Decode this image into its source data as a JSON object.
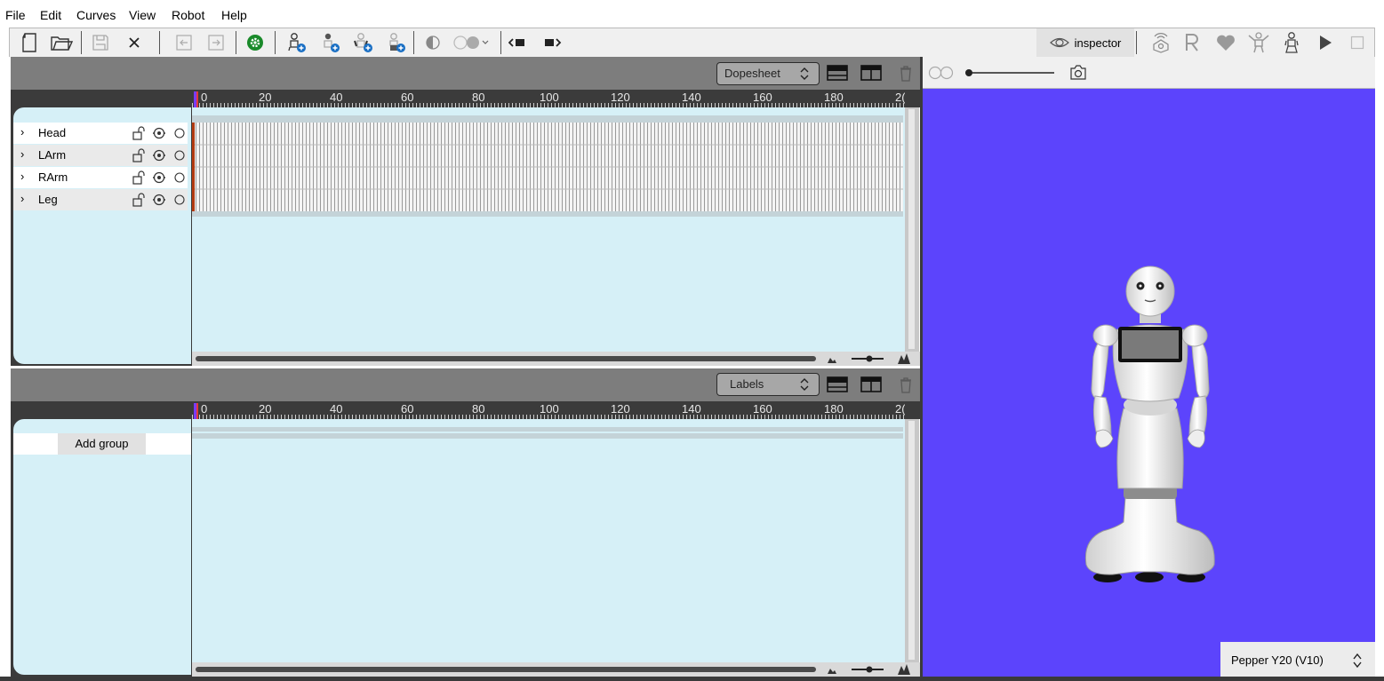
{
  "menu": [
    "File",
    "Edit",
    "Curves",
    "View",
    "Robot",
    "Help"
  ],
  "toolbar": {
    "inspector_label": "inspector"
  },
  "timeline_panel": {
    "mode": "Dopesheet",
    "ruler_labels": [
      "0",
      "20",
      "40",
      "60",
      "80",
      "100",
      "120",
      "140",
      "160",
      "180",
      "2("
    ],
    "groups": [
      {
        "label": "Head"
      },
      {
        "label": "LArm"
      },
      {
        "label": "RArm"
      },
      {
        "label": "Leg"
      }
    ]
  },
  "labels_panel": {
    "mode": "Labels",
    "ruler_labels": [
      "0",
      "20",
      "40",
      "60",
      "80",
      "100",
      "120",
      "140",
      "160",
      "180",
      "2("
    ],
    "add_group_label": "Add group"
  },
  "viewer": {
    "background_color": "#5c44fc",
    "robot_model": "Pepper Y20 (V10)"
  },
  "colors": {
    "panel_bg": "#d6f0f7",
    "header_bg": "#7d7d7d",
    "ruler_bg": "#3b3b3b",
    "accent_green": "#1a8a2a",
    "accent_blue": "#1a6fc4"
  }
}
